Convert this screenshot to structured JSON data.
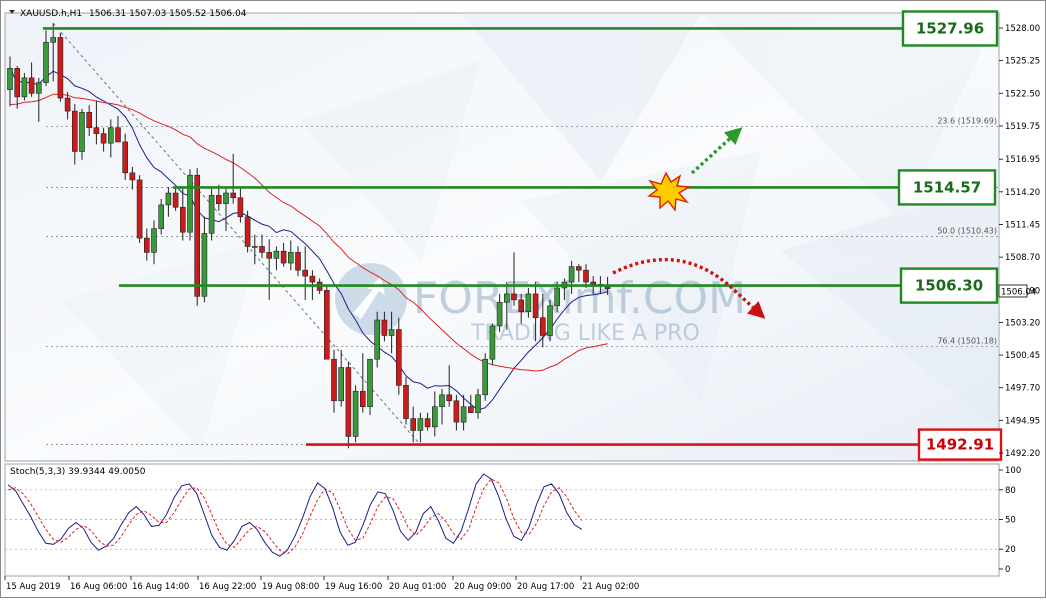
{
  "header": {
    "symbol": "XAUUSD.h,H1",
    "ohlc": "1506.31 1507.03 1505.52 1506.04"
  },
  "indicator_label": "Stoch(5,3,3) 39.9344 49.0050",
  "watermark": {
    "brand": "FOREXimf.COM",
    "tagline": "TRADING LIKE A PRO"
  },
  "current_price_tag": "1506.04",
  "colors": {
    "bull": "#3a9a3a",
    "bear": "#cc1b1b",
    "support_green": "#1f8a1f",
    "resistance_red": "#dd1111",
    "ma_fast": "#1e1e8c",
    "ma_slow": "#dd2222",
    "stoch_main": "#1e1e8c",
    "stoch_signal": "#dd2222"
  },
  "chart_data": [
    {
      "type": "candlestick",
      "title": "XAUUSD.h,H1",
      "y_ticks": [
        "1528.00",
        "1525.25",
        "1522.50",
        "1519.75",
        "1516.95",
        "1514.20",
        "1511.45",
        "1508.70",
        "1505.90",
        "1503.20",
        "1500.45",
        "1497.70",
        "1494.95",
        "1492.20"
      ],
      "x_ticks": [
        "15 Aug 2019",
        "16 Aug 06:00",
        "16 Aug 14:00",
        "16 Aug 22:00",
        "19 Aug 08:00",
        "19 Aug 16:00",
        "20 Aug 01:00",
        "20 Aug 09:00",
        "20 Aug 17:00",
        "21 Aug 02:00"
      ],
      "ylim": [
        1492.2,
        1528.8
      ],
      "levels": [
        {
          "label": "1527.96",
          "value": 1527.96,
          "color": "#1f8a1f"
        },
        {
          "label": "1514.57",
          "value": 1514.57,
          "color": "#1f8a1f"
        },
        {
          "label": "1506.30",
          "value": 1506.3,
          "color": "#1f8a1f"
        },
        {
          "label": "1492.91",
          "value": 1492.91,
          "color": "#dd1111"
        }
      ],
      "fib_levels": [
        {
          "label": "23.6 (1519.69)",
          "value": 1519.69
        },
        {
          "label": "50.0 (1510.43)",
          "value": 1510.43
        },
        {
          "label": "76.4 (1501.18)",
          "value": 1501.18
        }
      ],
      "series": [
        {
          "name": "XAUUSD.h",
          "ohlc": [
            [
              1522.8,
              1525.6,
              1521.4,
              1524.6
            ],
            [
              1524.6,
              1524.8,
              1521.2,
              1522.2
            ],
            [
              1522.2,
              1524.2,
              1521.9,
              1523.8
            ],
            [
              1523.8,
              1525.1,
              1522.2,
              1522.5
            ],
            [
              1522.5,
              1523.8,
              1520.1,
              1523.4
            ],
            [
              1523.4,
              1527.8,
              1523.1,
              1526.8
            ],
            [
              1526.8,
              1528.4,
              1523.5,
              1527.2
            ],
            [
              1527.2,
              1527.6,
              1521.8,
              1522.1
            ],
            [
              1522.1,
              1522.6,
              1520.3,
              1521.0
            ],
            [
              1521.0,
              1521.6,
              1516.5,
              1517.6
            ],
            [
              1517.6,
              1521.2,
              1516.9,
              1520.9
            ],
            [
              1520.9,
              1521.5,
              1518.9,
              1519.6
            ],
            [
              1519.6,
              1521.9,
              1518.2,
              1519.1
            ],
            [
              1519.1,
              1519.6,
              1517.6,
              1518.3
            ],
            [
              1518.3,
              1520.3,
              1517.1,
              1519.6
            ],
            [
              1519.6,
              1520.6,
              1518.9,
              1518.4
            ],
            [
              1518.4,
              1519.1,
              1515.2,
              1515.8
            ],
            [
              1515.8,
              1516.3,
              1514.4,
              1515.2
            ],
            [
              1515.2,
              1515.6,
              1509.9,
              1510.3
            ],
            [
              1510.3,
              1511.1,
              1508.4,
              1509.1
            ],
            [
              1509.1,
              1511.8,
              1508.1,
              1511.1
            ],
            [
              1511.1,
              1513.6,
              1510.6,
              1513.1
            ],
            [
              1513.1,
              1514.6,
              1512.1,
              1514.1
            ],
            [
              1514.1,
              1514.6,
              1512.6,
              1512.9
            ],
            [
              1512.9,
              1514.6,
              1510.1,
              1510.8
            ],
            [
              1510.8,
              1516.1,
              1510.1,
              1515.6
            ],
            [
              1515.6,
              1516.2,
              1504.6,
              1505.4
            ],
            [
              1505.4,
              1512.1,
              1504.9,
              1510.7
            ],
            [
              1510.7,
              1514.6,
              1510.1,
              1513.9
            ],
            [
              1513.9,
              1514.8,
              1512.6,
              1513.2
            ],
            [
              1513.2,
              1514.6,
              1510.9,
              1514.1
            ],
            [
              1514.1,
              1517.4,
              1513.2,
              1513.7
            ],
            [
              1513.7,
              1514.6,
              1511.6,
              1512.1
            ],
            [
              1512.1,
              1512.6,
              1509.1,
              1509.6
            ],
            [
              1509.6,
              1510.6,
              1508.1,
              1509.6
            ],
            [
              1509.6,
              1510.6,
              1508.6,
              1509.1
            ],
            [
              1509.1,
              1510.2,
              1505.1,
              1508.6
            ],
            [
              1508.6,
              1509.6,
              1507.6,
              1509.2
            ],
            [
              1509.2,
              1509.9,
              1507.9,
              1508.2
            ],
            [
              1508.2,
              1510.1,
              1507.6,
              1509.1
            ],
            [
              1509.1,
              1509.6,
              1507.1,
              1507.6
            ],
            [
              1507.6,
              1509.6,
              1505.1,
              1507.1
            ],
            [
              1507.1,
              1507.6,
              1505.1,
              1506.6
            ],
            [
              1506.6,
              1506.9,
              1505.6,
              1505.9
            ],
            [
              1505.9,
              1506.4,
              1500.6,
              1500.1
            ],
            [
              1500.1,
              1500.9,
              1495.6,
              1496.6
            ],
            [
              1496.6,
              1500.9,
              1496.1,
              1499.4
            ],
            [
              1499.4,
              1499.9,
              1492.6,
              1493.6
            ],
            [
              1493.6,
              1497.9,
              1493.1,
              1497.4
            ],
            [
              1497.4,
              1500.6,
              1495.6,
              1496.1
            ],
            [
              1496.1,
              1500.1,
              1495.4,
              1500.1
            ],
            [
              1500.1,
              1504.1,
              1499.4,
              1503.4
            ],
            [
              1503.4,
              1504.1,
              1501.6,
              1502.1
            ],
            [
              1502.1,
              1504.1,
              1500.6,
              1502.6
            ],
            [
              1502.6,
              1503.6,
              1497.1,
              1497.9
            ],
            [
              1497.9,
              1498.6,
              1494.6,
              1495.1
            ],
            [
              1495.1,
              1496.1,
              1493.1,
              1494.1
            ],
            [
              1494.1,
              1495.6,
              1493.1,
              1495.1
            ],
            [
              1495.1,
              1495.6,
              1494.1,
              1494.4
            ],
            [
              1494.4,
              1497.4,
              1493.6,
              1496.1
            ],
            [
              1496.1,
              1497.6,
              1494.6,
              1497.1
            ],
            [
              1497.1,
              1499.6,
              1496.1,
              1496.6
            ],
            [
              1496.6,
              1497.1,
              1494.1,
              1494.8
            ],
            [
              1494.8,
              1497.1,
              1494.1,
              1496.1
            ],
            [
              1496.1,
              1497.1,
              1495.6,
              1495.6
            ],
            [
              1495.6,
              1497.6,
              1495.1,
              1497.1
            ],
            [
              1497.1,
              1500.6,
              1496.6,
              1500.1
            ],
            [
              1500.1,
              1503.1,
              1499.6,
              1502.9
            ],
            [
              1502.9,
              1505.6,
              1502.4,
              1504.9
            ],
            [
              1504.9,
              1506.6,
              1502.6,
              1505.6
            ],
            [
              1505.6,
              1509.1,
              1504.6,
              1505.1
            ],
            [
              1505.1,
              1505.6,
              1503.1,
              1504.1
            ],
            [
              1504.1,
              1506.1,
              1503.6,
              1505.6
            ],
            [
              1505.6,
              1506.6,
              1501.6,
              1503.6
            ],
            [
              1503.6,
              1505.6,
              1501.1,
              1502.1
            ],
            [
              1502.1,
              1505.1,
              1501.6,
              1504.6
            ],
            [
              1504.6,
              1506.6,
              1504.1,
              1506.1
            ],
            [
              1506.1,
              1506.9,
              1505.1,
              1506.6
            ],
            [
              1506.6,
              1508.4,
              1505.6,
              1507.9
            ],
            [
              1507.9,
              1508.1,
              1506.6,
              1507.6
            ],
            [
              1507.6,
              1508.1,
              1506.1,
              1506.6
            ],
            [
              1506.6,
              1507.1,
              1505.6,
              1506.4
            ],
            [
              1506.4,
              1507.1,
              1505.6,
              1506.3
            ],
            [
              1506.31,
              1507.03,
              1505.52,
              1506.04
            ]
          ]
        }
      ]
    },
    {
      "type": "line",
      "title": "Stoch(5,3,3) 39.9344 49.0050",
      "y_ticks": [
        "100",
        "80",
        "50",
        "20",
        "0"
      ],
      "ylim": [
        0,
        100
      ],
      "levels": [
        80,
        50,
        20
      ],
      "series": [
        {
          "name": "39.9344",
          "values": [
            85,
            79,
            66,
            53,
            38,
            26,
            25,
            30,
            41,
            47,
            41,
            27,
            19,
            23,
            31,
            45,
            57,
            63,
            55,
            43,
            44,
            55,
            72,
            84,
            86,
            76,
            55,
            34,
            22,
            19,
            29,
            43,
            47,
            40,
            27,
            17,
            13,
            19,
            33,
            51,
            73,
            87,
            81,
            62,
            37,
            24,
            27,
            44,
            65,
            78,
            76,
            59,
            38,
            29,
            37,
            56,
            63,
            49,
            31,
            26,
            38,
            61,
            86,
            96,
            91,
            73,
            50,
            33,
            29,
            42,
            65,
            83,
            86,
            76,
            57,
            45,
            40
          ]
        },
        {
          "name": "49.0050",
          "values": [
            80,
            82,
            76,
            66,
            53,
            40,
            30,
            27,
            32,
            40,
            44,
            39,
            29,
            23,
            24,
            33,
            45,
            55,
            59,
            54,
            47,
            47,
            57,
            70,
            81,
            82,
            72,
            55,
            37,
            25,
            22,
            31,
            40,
            43,
            38,
            28,
            19,
            15,
            22,
            35,
            53,
            70,
            81,
            77,
            60,
            41,
            29,
            31,
            46,
            63,
            73,
            71,
            58,
            42,
            34,
            41,
            52,
            56,
            48,
            36,
            30,
            40,
            62,
            81,
            91,
            87,
            72,
            51,
            37,
            35,
            46,
            64,
            78,
            82,
            73,
            59,
            49
          ]
        }
      ]
    }
  ]
}
